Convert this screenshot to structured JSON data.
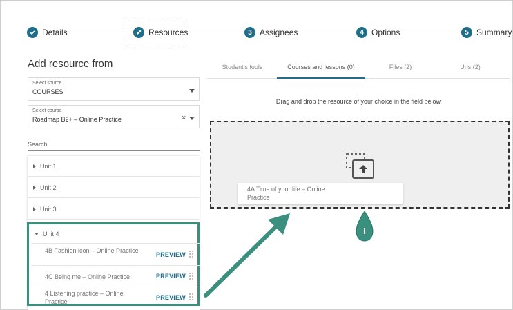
{
  "stepper": {
    "steps": [
      {
        "number": "",
        "label": "Details",
        "icon": "check-icon"
      },
      {
        "number": "",
        "label": "Resources",
        "icon": "pencil-icon"
      },
      {
        "number": "3",
        "label": "Assignees"
      },
      {
        "number": "4",
        "label": "Options"
      },
      {
        "number": "5",
        "label": "Summary"
      }
    ]
  },
  "left_panel": {
    "title": "Add resource from",
    "source_select": {
      "label": "Select source",
      "value": "COURSES"
    },
    "course_select": {
      "label": "Select course",
      "value": "Roadmap B2+ – Online Practice"
    },
    "search_placeholder": "Search",
    "units": [
      {
        "label": "Unit 1",
        "expanded": false
      },
      {
        "label": "Unit 2",
        "expanded": false
      },
      {
        "label": "Unit 3",
        "expanded": false
      },
      {
        "label": "Unit 4",
        "expanded": true
      }
    ],
    "lessons": [
      {
        "title": "4B Fashion icon – Online Practice",
        "action": "PREVIEW"
      },
      {
        "title": "4C Being me – Online Practice",
        "action": "PREVIEW"
      },
      {
        "title": "4 Listening practice – Online Practice",
        "action": "PREVIEW"
      }
    ]
  },
  "tabs": [
    {
      "label": "Student's tools",
      "active": false
    },
    {
      "label": "Courses and lessons (0)",
      "active": true
    },
    {
      "label": "Files (2)",
      "active": false
    },
    {
      "label": "Urls (2)",
      "active": false
    }
  ],
  "dropzone": {
    "instruction": "Drag and drop the resource of your choice in the field below",
    "dragged_item": "4A Time of your life – Online Practice"
  },
  "annotation": {
    "pin_label": "I"
  },
  "colors": {
    "accent": "#1f6f8b",
    "highlight": "#3a8f7e"
  }
}
